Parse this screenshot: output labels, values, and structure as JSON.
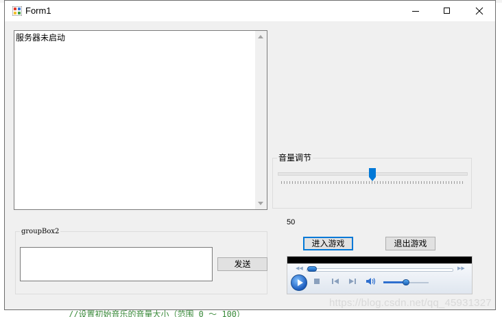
{
  "window": {
    "title": "Form1"
  },
  "log_box": {
    "text": "服务器未启动"
  },
  "volume_group": {
    "label": "音量调节",
    "value": 50,
    "max": 100
  },
  "value_label": "50",
  "send_group": {
    "label": "groupBox2",
    "send_button": "发送",
    "message_value": ""
  },
  "buttons": {
    "enter_game": "进入游戏",
    "exit_game": "退出游戏"
  },
  "player": {
    "volume_level": 0.5,
    "progress": 0.0
  },
  "background_code": "//设置初始音乐的音量大小（范围 0 ～ 100）",
  "watermark": "https://blog.csdn.net/qq_45931327"
}
